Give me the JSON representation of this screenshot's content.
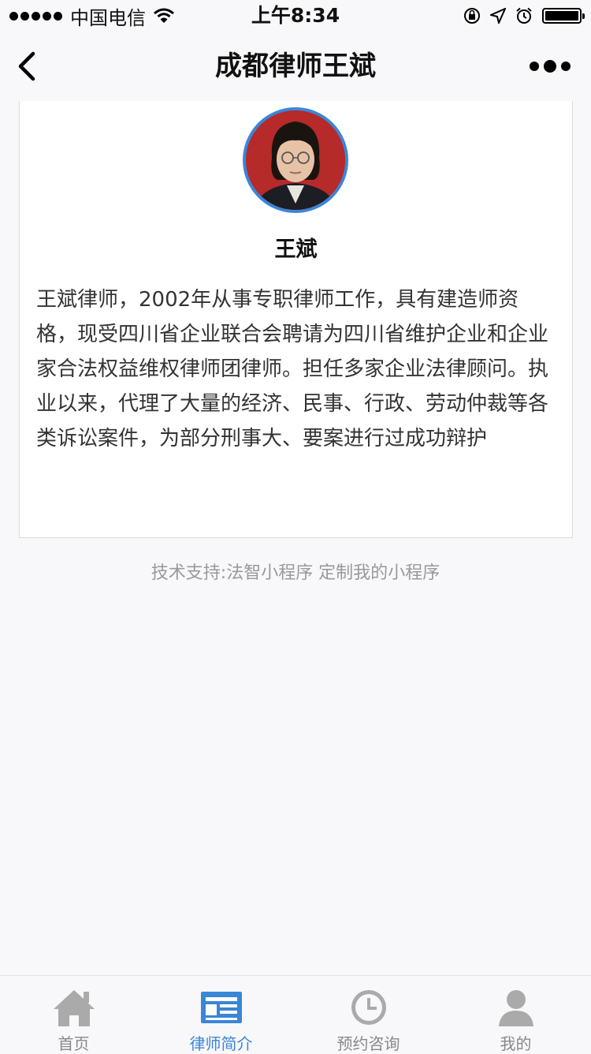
{
  "status_bar": {
    "carrier": "中国电信",
    "time": "上午8:34"
  },
  "nav": {
    "title": "成都律师王斌"
  },
  "profile": {
    "name": "王斌",
    "bio": "王斌律师，2002年从事专职律师工作，具有建造师资格，现受四川省企业联合会聘请为四川省维护企业和企业家合法权益维权律师团律师。担任多家企业法律顾问。执业以来，代理了大量的经济、民事、行政、劳动仲裁等各类诉讼案件，为部分刑事大、要案进行过成功辩护"
  },
  "footer_note": "技术支持:法智小程序 定制我的小程序",
  "tabs": [
    {
      "label": "首页",
      "icon": "home-icon",
      "active": false
    },
    {
      "label": "律师简介",
      "icon": "profile-card-icon",
      "active": true
    },
    {
      "label": "预约咨询",
      "icon": "clock-icon",
      "active": false
    },
    {
      "label": "我的",
      "icon": "user-icon",
      "active": false
    }
  ],
  "colors": {
    "accent": "#3a86d8",
    "tab_inactive": "#aaaaaa",
    "background": "#f8f7fa"
  }
}
